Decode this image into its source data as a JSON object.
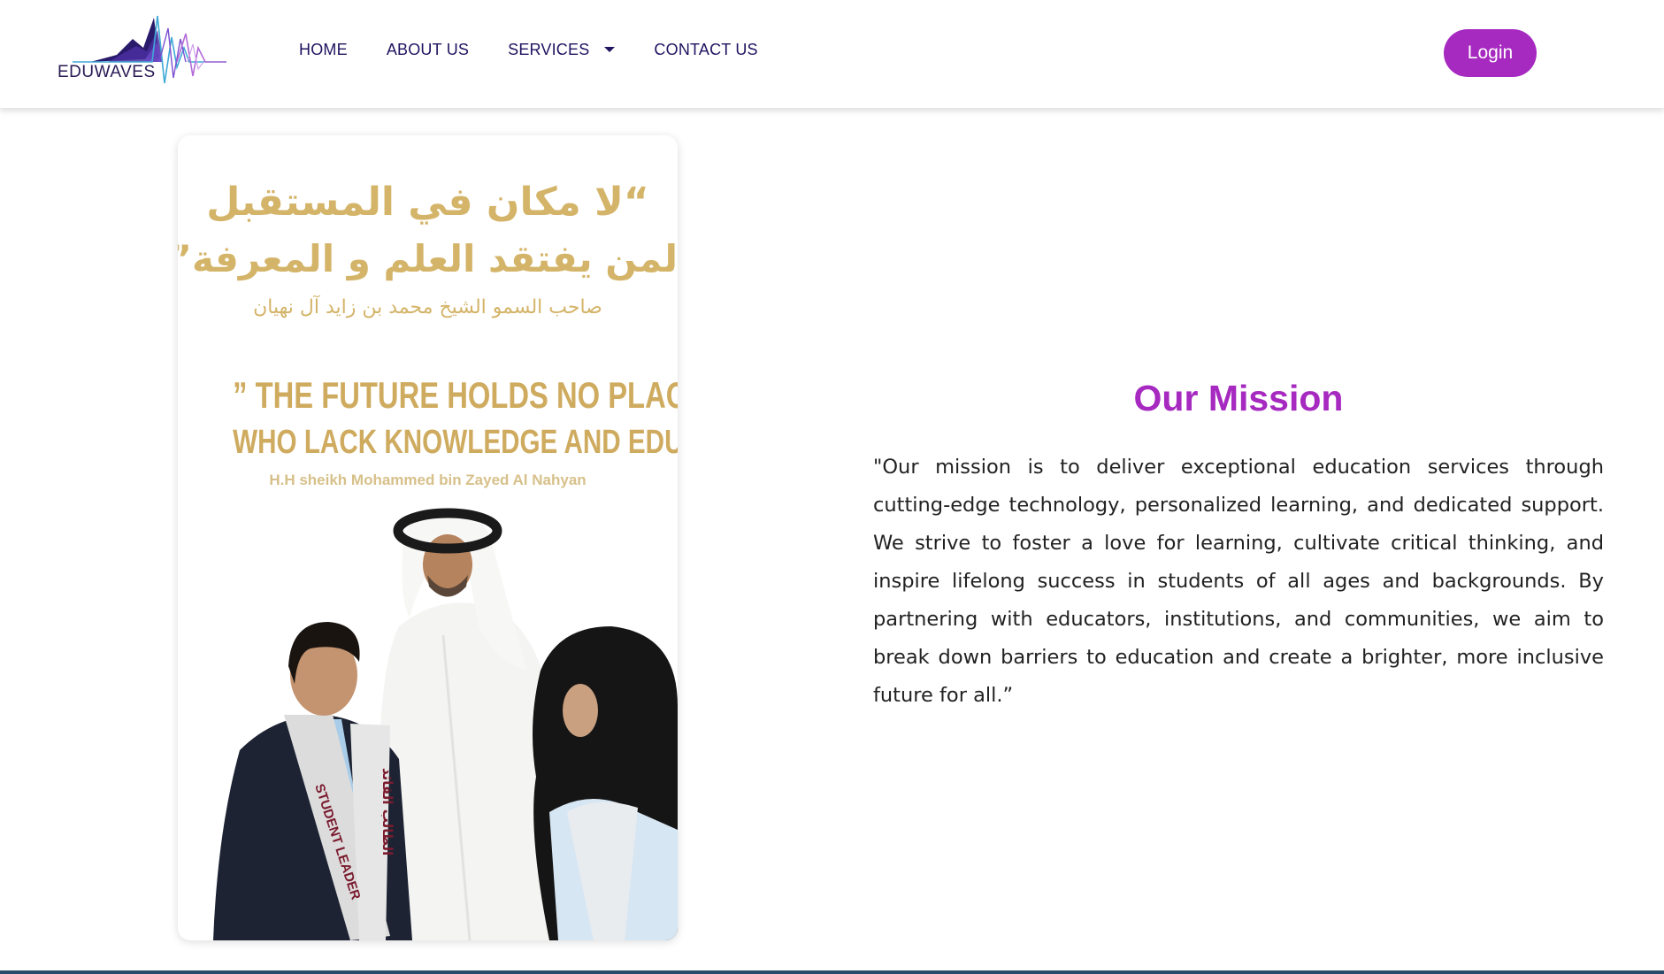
{
  "header": {
    "logo": {
      "text": "EDUWAVES"
    },
    "nav": {
      "home": "HOME",
      "about": "ABOUT US",
      "services": "SERVICES",
      "contact": "CONTACT US"
    },
    "login_label": "Login"
  },
  "colors": {
    "brand": "#a629c0",
    "nav_text": "#1f1460",
    "quote_gold": "#d4b468"
  },
  "quote_card": {
    "arabic_line1": "“لا مكان في المستقبل",
    "arabic_line2": "لمن يفتقد العلم و المعرفة”",
    "arabic_attribution": "صاحب السمو الشيخ محمد بن زايد آل نهيان",
    "english_line1": "” The future holds no place for those",
    "english_line2": "who lack knowledge and education”",
    "english_attribution": "H.H sheikh Mohammed bin Zayed Al Nahyan",
    "sash_text_left": "STUDENT LEADER",
    "sash_text_right": "الطالب القائد"
  },
  "mission": {
    "title": "Our Mission",
    "text": "\"Our mission is to deliver exceptional education services through cutting-edge technology, personalized learning, and dedicated support. We strive to foster a love for learning, cultivate critical thinking, and inspire lifelong success in students of all ages and backgrounds. By partnering with educators, institutions, and communities, we aim to break down barriers to education and create a brighter, more inclusive future for all.”"
  }
}
